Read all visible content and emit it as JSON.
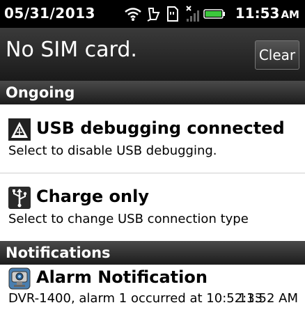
{
  "status_bar": {
    "date": "05/31/2013",
    "time": "11:53",
    "ampm": "AM",
    "icons": [
      "wifi-icon",
      "sync-icon",
      "sd-card-icon",
      "no-signal-icon",
      "battery-icon"
    ]
  },
  "header": {
    "carrier_text": "No SIM card.",
    "clear_label": "Clear"
  },
  "sections": {
    "ongoing": "Ongoing",
    "notifications": "Notifications"
  },
  "ongoing": [
    {
      "title": "USB debugging connected",
      "desc": "Select to disable USB debugging.",
      "icon": "usb-debugging-icon"
    },
    {
      "title": "Charge only",
      "desc": "Select to change USB connection type",
      "icon": "usb-charge-icon"
    }
  ],
  "notifications": [
    {
      "title": "Alarm Notification",
      "desc": "DVR-1400, alarm 1 occurred at 10:52:33",
      "time": "11:52 AM",
      "icon": "alarm-camera-icon"
    }
  ],
  "colors": {
    "status_bar_bg": "#000000",
    "header_bg": "#2a2a2a",
    "section_bg": "#333333",
    "list_bg": "#ffffff",
    "battery_green": "#3cc83c"
  }
}
